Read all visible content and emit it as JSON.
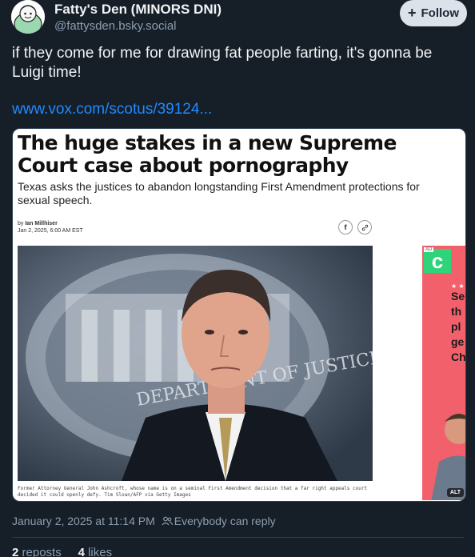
{
  "author": {
    "display_name": "Fatty's Den (MINORS DNI)",
    "handle": "@fattysden.bsky.social",
    "follow_label": "Follow",
    "follow_icon": "plus-icon"
  },
  "post": {
    "text": "if they come for me for drawing fat people farting, it's gonna be Luigi time!",
    "link": "www.vox.com/scotus/39124..."
  },
  "embed": {
    "title": "The huge stakes in a new Supreme Court case about pornography",
    "subtitle": "Texas asks the justices to abandon longstanding First Amendment protections for sexual speech.",
    "byline_prefix": "by ",
    "author": "Ian Millhiser",
    "date": "Jan 2, 2025, 6:00 AM EST",
    "share_facebook": "f",
    "share_link": "🔗",
    "photo_sign_text": "DEPARTMENT OF JUSTICE",
    "caption": "Former Attorney General John Ashcroft, whose name is on a seminal First Amendment decision that a far right appeals court decided it could openly defy. Tim Sloan/AFP via Getty Images",
    "ad": {
      "label": "AD",
      "logo": "c",
      "stars": "★ ★",
      "text_lines": [
        "Se",
        "th",
        "pl",
        "ge",
        "Ch"
      ],
      "alt": "ALT"
    }
  },
  "footer": {
    "timestamp": "January 2, 2025 at 11:14 PM",
    "reply_setting": "Everybody can reply",
    "reposts_count": "2",
    "reposts_label": "reposts",
    "likes_count": "4",
    "likes_label": "likes"
  },
  "colors": {
    "background": "#161e27",
    "link": "#208bfe",
    "muted": "#8d9eb2",
    "follow_bg": "#dce2ea"
  }
}
